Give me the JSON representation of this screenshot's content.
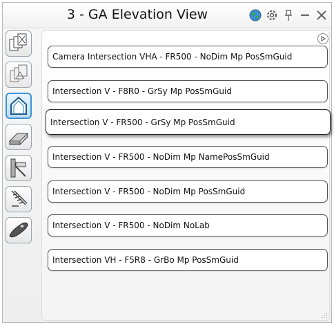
{
  "window": {
    "title": "3 - GA Elevation View"
  },
  "title_tools": [
    {
      "name": "globe-icon",
      "interactable": true
    },
    {
      "name": "gear-icon",
      "interactable": true
    },
    {
      "name": "pin-icon",
      "interactable": true
    },
    {
      "name": "minimize-icon",
      "interactable": true
    },
    {
      "name": "close-icon",
      "interactable": true
    }
  ],
  "side_buttons": [
    {
      "name": "multi-views-icon",
      "active": false
    },
    {
      "name": "views-outline-icon",
      "active": false
    },
    {
      "name": "house-elevation-icon",
      "active": true
    },
    {
      "name": "beam-section-icon",
      "active": false
    },
    {
      "name": "column-profile-icon",
      "active": false
    },
    {
      "name": "stair-icon",
      "active": false
    },
    {
      "name": "plate-icon",
      "active": false
    }
  ],
  "items": [
    {
      "label": "Camera Intersection VHA - FR500 - NoDim Mp PosSmGuid",
      "selected": false
    },
    {
      "label": "Intersection V - F8R0 - GrSy Mp PosSmGuid",
      "selected": false
    },
    {
      "label": "Intersection V - FR500 - GrSy Mp PosSmGuid",
      "selected": true
    },
    {
      "label": "Intersection V - FR500 - NoDim Mp NamePosSmGuid",
      "selected": false
    },
    {
      "label": "Intersection V - FR500 - NoDim Mp PosSmGuid",
      "selected": false
    },
    {
      "label": "Intersection V - FR500 - NoDim NoLab",
      "selected": false
    },
    {
      "label": "Intersection VH - F5R8 - GrBo Mp PosSmGuid",
      "selected": false
    }
  ],
  "colors": {
    "accent": "#3b93d6",
    "globe": "#2e8b57"
  }
}
